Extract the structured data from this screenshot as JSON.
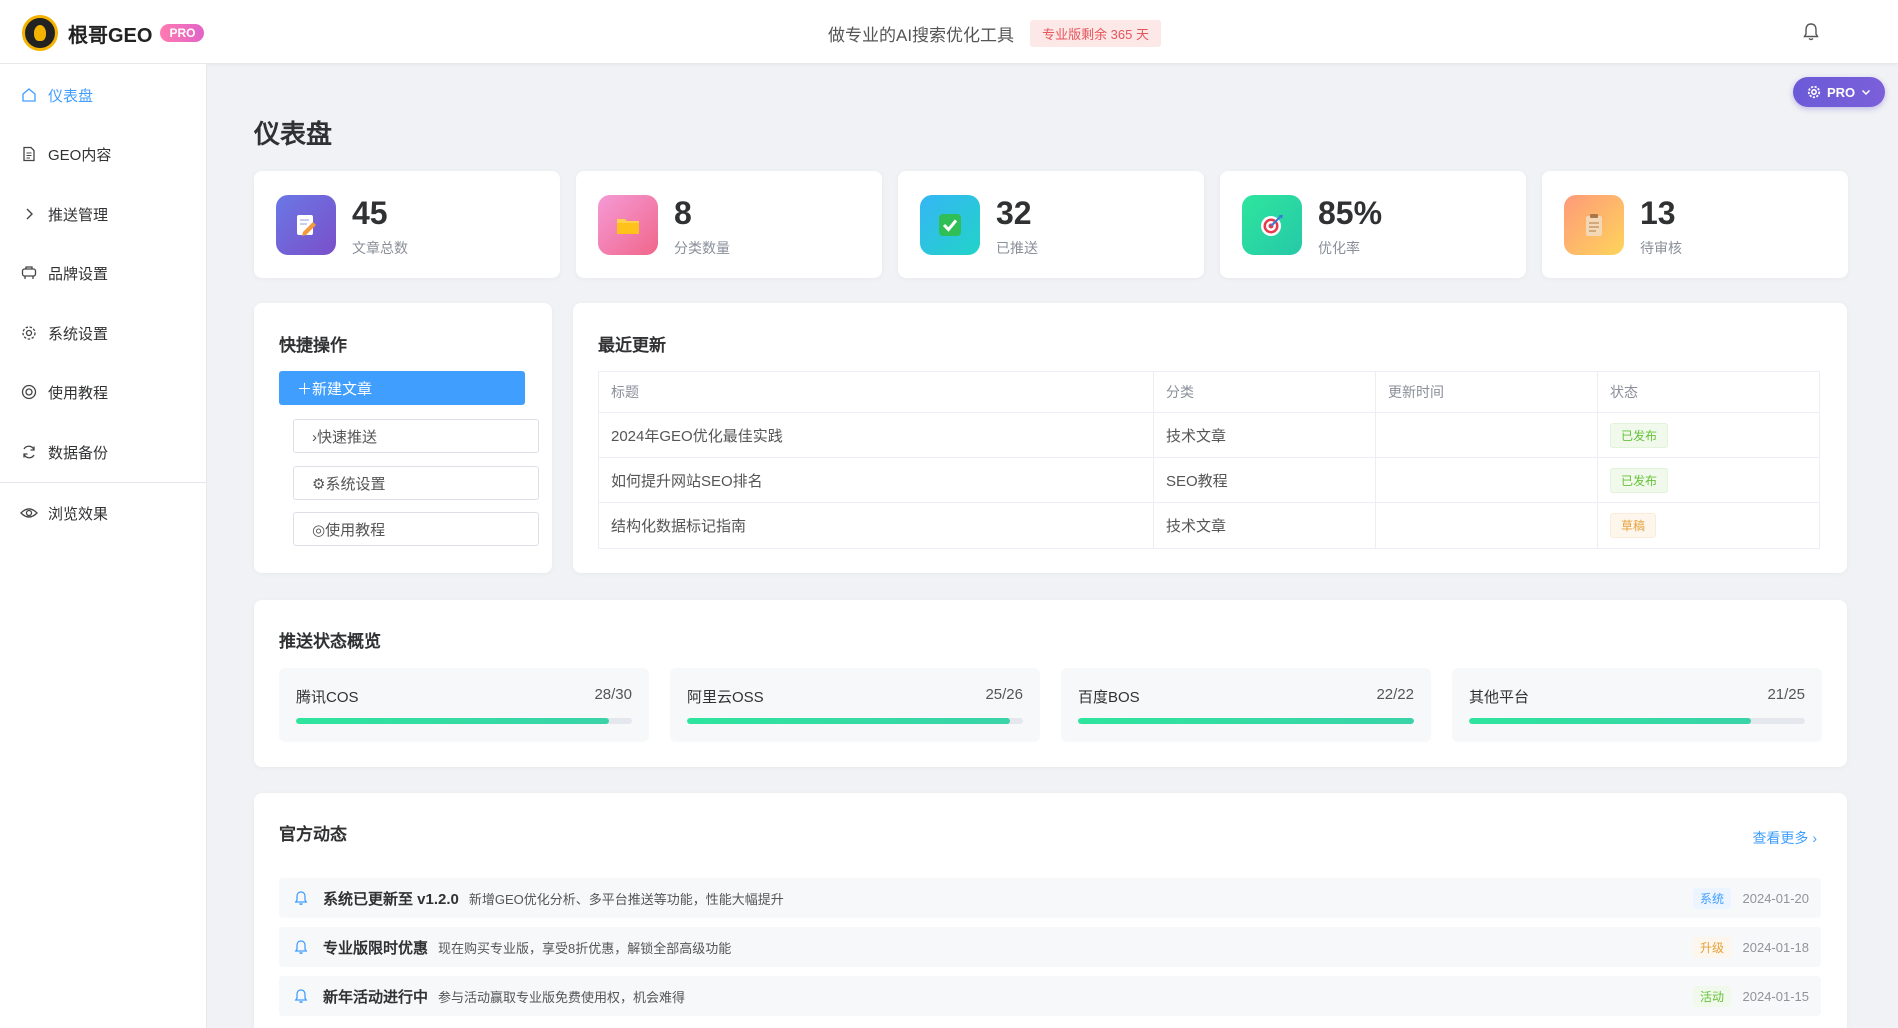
{
  "header": {
    "logo_text": "根哥GEO",
    "pro_badge": "PRO",
    "slogan": "做专业的AI搜索优化工具",
    "subscription_badge": "专业版剩余 365 天"
  },
  "sidebar": {
    "items": [
      {
        "label": "仪表盘",
        "icon": "home-icon"
      },
      {
        "label": "GEO内容",
        "icon": "document-icon"
      },
      {
        "label": "推送管理",
        "icon": "chevron-right-icon"
      },
      {
        "label": "品牌设置",
        "icon": "brand-icon"
      },
      {
        "label": "系统设置",
        "icon": "gear-icon"
      },
      {
        "label": "使用教程",
        "icon": "lifebuoy-icon"
      },
      {
        "label": "数据备份",
        "icon": "refresh-icon"
      },
      {
        "label": "浏览效果",
        "icon": "eye-icon"
      }
    ]
  },
  "pro_float": {
    "label": "PRO"
  },
  "page_title": "仪表盘",
  "stats": [
    {
      "value": "45",
      "label": "文章总数",
      "icon": "edit-document-icon"
    },
    {
      "value": "8",
      "label": "分类数量",
      "icon": "folder-icon"
    },
    {
      "value": "32",
      "label": "已推送",
      "icon": "checkbox-icon"
    },
    {
      "value": "85%",
      "label": "优化率",
      "icon": "target-icon"
    },
    {
      "value": "13",
      "label": "待审核",
      "icon": "clipboard-icon"
    }
  ],
  "quick_actions": {
    "title": "快捷操作",
    "primary": "＋新建文章",
    "buttons": [
      "›快速推送",
      "⚙系统设置",
      "◎使用教程"
    ]
  },
  "recent_updates": {
    "title": "最近更新",
    "columns": [
      "标题",
      "分类",
      "更新时间",
      "状态"
    ],
    "rows": [
      {
        "title": "2024年GEO优化最佳实践",
        "category": "技术文章",
        "time": "",
        "status": "已发布"
      },
      {
        "title": "如何提升网站SEO排名",
        "category": "SEO教程",
        "time": "",
        "status": "已发布"
      },
      {
        "title": "结构化数据标记指南",
        "category": "技术文章",
        "time": "",
        "status": "草稿"
      }
    ]
  },
  "push_status": {
    "title": "推送状态概览",
    "platforms": [
      {
        "name": "腾讯COS",
        "count": "28/30",
        "progress": 0.933
      },
      {
        "name": "阿里云OSS",
        "count": "25/26",
        "progress": 0.962
      },
      {
        "name": "百度BOS",
        "count": "22/22",
        "progress": 1.0
      },
      {
        "name": "其他平台",
        "count": "21/25",
        "progress": 0.84
      }
    ]
  },
  "news": {
    "title": "官方动态",
    "more": "查看更多",
    "items": [
      {
        "title": "系统已更新至 v1.2.0",
        "desc": "新增GEO优化分析、多平台推送等功能，性能大幅提升",
        "tag": "系统",
        "date": "2024-01-20"
      },
      {
        "title": "专业版限时优惠",
        "desc": "现在购买专业版，享受8折优惠，解锁全部高级功能",
        "tag": "升级",
        "date": "2024-01-18"
      },
      {
        "title": "新年活动进行中",
        "desc": "参与活动赢取专业版免费使用权，机会难得",
        "tag": "活动",
        "date": "2024-01-15"
      }
    ]
  },
  "colors": {
    "primary": "#409eff",
    "published": "#67c23a",
    "draft": "#e6a23c",
    "progress": "#2ee59d"
  }
}
